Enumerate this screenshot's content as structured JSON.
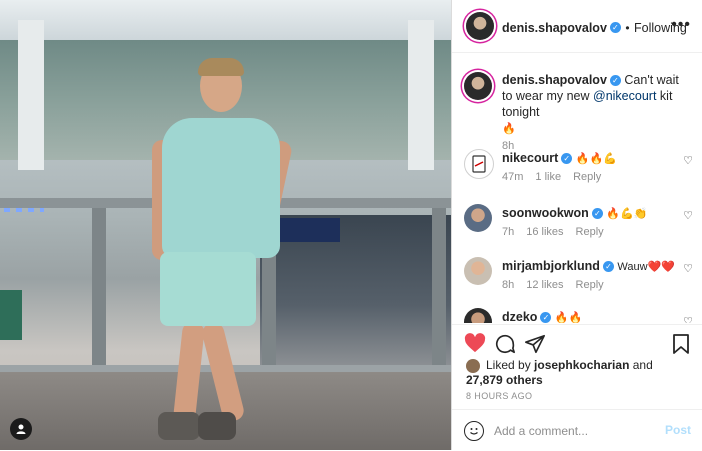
{
  "post": {
    "author": "denis.shapovalov",
    "follow_status": "Following",
    "more_icon": "more-horizontal-icon",
    "caption_prefix": "Can't wait to wear my new ",
    "caption_mention": "@nikecourt",
    "caption_suffix": " kit tonight",
    "caption_emoji": "🔥",
    "caption_time": "8h"
  },
  "comments": [
    {
      "user": "nikecourt",
      "text": "🔥🔥💪",
      "time": "47m",
      "likes": "1 like",
      "reply": "Reply",
      "verified": true
    },
    {
      "user": "soonwookwon",
      "text": "🔥💪👏",
      "time": "7h",
      "likes": "16 likes",
      "reply": "Reply",
      "verified": true
    },
    {
      "user": "mirjambjorklund",
      "text": "Wauw❤️❤️",
      "time": "8h",
      "likes": "12 likes",
      "reply": "Reply",
      "verified": true
    },
    {
      "user": "dzeko",
      "text": "🔥🔥",
      "verified": true
    }
  ],
  "actions": {
    "like_icon": "heart-filled-icon",
    "comment_icon": "comment-icon",
    "share_icon": "send-icon",
    "save_icon": "bookmark-icon",
    "like_color": "#ed4956"
  },
  "likes": {
    "prefix": "Liked by ",
    "first_user": "josephkocharian",
    "middle": " and",
    "others": "27,879 others"
  },
  "timestamp": "8 HOURS AGO",
  "comment_box": {
    "placeholder": "Add a comment...",
    "post_label": "Post"
  },
  "photo": {
    "person_icon": "user-tag-icon"
  }
}
